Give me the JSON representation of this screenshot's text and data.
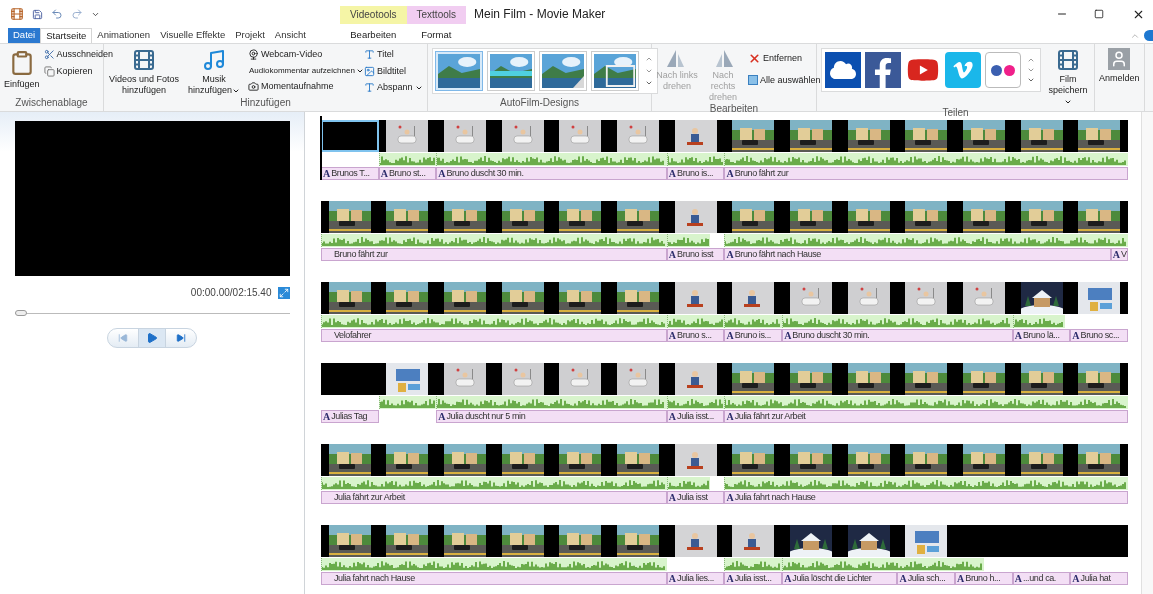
{
  "window": {
    "title": "Mein Film - Movie Maker"
  },
  "tabs": [
    {
      "label": "Datei",
      "kind": "file",
      "selected": false
    },
    {
      "label": "Startseite",
      "kind": "tab",
      "selected": true
    },
    {
      "label": "Animationen",
      "kind": "tab",
      "selected": false
    },
    {
      "label": "Visuelle Effekte",
      "kind": "tab",
      "selected": false
    },
    {
      "label": "Projekt",
      "kind": "tab",
      "selected": false
    },
    {
      "label": "Ansicht",
      "kind": "tab",
      "selected": false
    }
  ],
  "context_groups": [
    {
      "label": "Videotools",
      "color": "#f5f5a6",
      "tabs": [
        {
          "label": "Bearbeiten",
          "selected": false
        }
      ]
    },
    {
      "label": "Texttools",
      "color": "#f1cdf1",
      "tabs": [
        {
          "label": "Format",
          "selected": false
        }
      ]
    }
  ],
  "ribbon": {
    "clipboard": {
      "label": "Zwischenablage",
      "paste": "Einfügen",
      "cut": "Ausschneiden",
      "copy": "Kopieren"
    },
    "add": {
      "label": "Hinzufügen",
      "videos": "Videos und Fotos hinzufügen",
      "music": "Musik hinzufügen",
      "webcam": "Webcam-Video",
      "narration": "Audiokommentar aufzeichnen",
      "snapshot": "Momentaufnahme",
      "title": "Titel",
      "caption": "Bildtitel",
      "credits": "Abspann"
    },
    "themes": {
      "label": "AutoFilm-Designs",
      "items": [
        {
          "kind": "plain",
          "selected": true
        },
        {
          "kind": "banner",
          "selected": false
        },
        {
          "kind": "page",
          "selected": false
        },
        {
          "kind": "stack",
          "selected": false
        }
      ]
    },
    "edit": {
      "label": "Bearbeiten",
      "rotate_left": {
        "text": "Nach links drehen",
        "disabled": true
      },
      "rotate_right": {
        "text": "Nach rechts drehen",
        "disabled": true
      },
      "remove": "Entfernen",
      "select_all": "Alle auswählen"
    },
    "share": {
      "label": "Teilen",
      "items": [
        {
          "kind": "cloud"
        },
        {
          "kind": "facebook"
        },
        {
          "kind": "youtube"
        },
        {
          "kind": "vimeo"
        },
        {
          "kind": "flickr"
        }
      ],
      "save": "Film speichern"
    },
    "sign_in": "Anmelden"
  },
  "preview": {
    "time": "00:00.00/02:15.40",
    "level": 0
  },
  "timeline": {
    "rows": [
      {
        "frames": [
          {
            "kind": "blank",
            "selected": true
          },
          {
            "kind": "picture",
            "selected": false
          },
          {
            "kind": "picture",
            "selected": false
          },
          {
            "kind": "picture",
            "selected": false
          },
          {
            "kind": "picture",
            "selected": false
          },
          {
            "kind": "picture",
            "selected": false
          },
          {
            "kind": "picture",
            "selected": false
          },
          {
            "kind": "picture",
            "selected": false
          },
          {
            "kind": "picture",
            "selected": false
          },
          {
            "kind": "picture",
            "selected": false
          },
          {
            "kind": "picture",
            "selected": false
          },
          {
            "kind": "picture",
            "selected": false
          },
          {
            "kind": "picture",
            "selected": false
          },
          {
            "kind": "picture",
            "selected": false
          }
        ],
        "captions": [
          {
            "marker": "A",
            "text": "Brunos T..."
          },
          {
            "marker": "A",
            "text": "Bruno st..."
          },
          {
            "marker": "A",
            "text": "Bruno duscht 30 min."
          },
          {
            "marker": "A",
            "text": "Bruno is..."
          },
          {
            "marker": "A",
            "text": "Bruno fährt zur"
          }
        ]
      },
      {
        "frames": [
          {
            "kind": "picture",
            "selected": false
          },
          {
            "kind": "picture",
            "selected": false
          },
          {
            "kind": "picture",
            "selected": false
          },
          {
            "kind": "picture",
            "selected": false
          },
          {
            "kind": "picture",
            "selected": false
          },
          {
            "kind": "picture",
            "selected": false
          },
          {
            "kind": "picture",
            "selected": false
          },
          {
            "kind": "picture",
            "selected": false
          },
          {
            "kind": "picture",
            "selected": false
          },
          {
            "kind": "picture",
            "selected": false
          },
          {
            "kind": "picture",
            "selected": false
          },
          {
            "kind": "picture",
            "selected": false
          },
          {
            "kind": "picture",
            "selected": false
          },
          {
            "kind": "picture",
            "selected": false
          }
        ],
        "captions": [
          {
            "text": "Bruno fährt zur"
          },
          {
            "marker": "A",
            "text": "Bruno isst"
          },
          {
            "marker": "A",
            "text": "Bruno fährt nach Hause"
          },
          {
            "marker": "A",
            "text": "V"
          }
        ]
      },
      {
        "frames": [
          {
            "kind": "picture",
            "selected": false
          },
          {
            "kind": "picture",
            "selected": false
          },
          {
            "kind": "picture",
            "selected": false
          },
          {
            "kind": "picture",
            "selected": false
          },
          {
            "kind": "picture",
            "selected": false
          },
          {
            "kind": "picture",
            "selected": false
          },
          {
            "kind": "picture",
            "selected": false
          },
          {
            "kind": "picture",
            "selected": false
          },
          {
            "kind": "picture",
            "selected": false
          },
          {
            "kind": "picture",
            "selected": false
          },
          {
            "kind": "picture",
            "selected": false
          },
          {
            "kind": "picture",
            "selected": false
          },
          {
            "kind": "picture",
            "selected": false
          },
          {
            "kind": "picture",
            "selected": false
          }
        ],
        "captions": [
          {
            "text": "Velofahrer"
          },
          {
            "marker": "A",
            "text": "Bruno s..."
          },
          {
            "marker": "A",
            "text": "Bruno is..."
          },
          {
            "marker": "A",
            "text": "Bruno duscht 30 min."
          },
          {
            "marker": "A",
            "text": "Bruno lä..."
          },
          {
            "marker": "A",
            "text": "Bruno sc..."
          }
        ]
      },
      {
        "frames": [
          {
            "kind": "blank",
            "selected": false
          },
          {
            "kind": "picture",
            "selected": false
          },
          {
            "kind": "picture",
            "selected": false
          },
          {
            "kind": "picture",
            "selected": false
          },
          {
            "kind": "picture",
            "selected": false
          },
          {
            "kind": "picture",
            "selected": false
          },
          {
            "kind": "picture",
            "selected": false
          },
          {
            "kind": "picture",
            "selected": false
          },
          {
            "kind": "picture",
            "selected": false
          },
          {
            "kind": "picture",
            "selected": false
          },
          {
            "kind": "picture",
            "selected": false
          },
          {
            "kind": "picture",
            "selected": false
          },
          {
            "kind": "picture",
            "selected": false
          },
          {
            "kind": "picture",
            "selected": false
          }
        ],
        "captions": [
          {
            "marker": "A",
            "text": "Julias Tag"
          },
          {
            "marker": "A",
            "text": "Julia duscht nur 5 min"
          },
          {
            "marker": "A",
            "text": "Julia isst..."
          },
          {
            "marker": "A",
            "text": "Julia fährt zur Arbeit"
          }
        ]
      },
      {
        "frames": [
          {
            "kind": "picture",
            "selected": false
          },
          {
            "kind": "picture",
            "selected": false
          },
          {
            "kind": "picture",
            "selected": false
          },
          {
            "kind": "picture",
            "selected": false
          },
          {
            "kind": "picture",
            "selected": false
          },
          {
            "kind": "picture",
            "selected": false
          },
          {
            "kind": "picture",
            "selected": false
          },
          {
            "kind": "picture",
            "selected": false
          },
          {
            "kind": "picture",
            "selected": false
          },
          {
            "kind": "picture",
            "selected": false
          },
          {
            "kind": "picture",
            "selected": false
          },
          {
            "kind": "picture",
            "selected": false
          },
          {
            "kind": "picture",
            "selected": false
          },
          {
            "kind": "picture",
            "selected": false
          }
        ],
        "captions": [
          {
            "text": "Julia fährt zur Arbeit"
          },
          {
            "marker": "A",
            "text": "Julia isst"
          },
          {
            "marker": "A",
            "text": "Julia fahrt nach Hause"
          }
        ]
      },
      {
        "frames": [
          {
            "kind": "picture",
            "selected": false
          },
          {
            "kind": "picture",
            "selected": false
          },
          {
            "kind": "picture",
            "selected": false
          },
          {
            "kind": "picture",
            "selected": false
          },
          {
            "kind": "picture",
            "selected": false
          },
          {
            "kind": "picture",
            "selected": false
          },
          {
            "kind": "picture",
            "selected": false
          },
          {
            "kind": "picture",
            "selected": false
          },
          {
            "kind": "picture",
            "selected": false
          },
          {
            "kind": "picture",
            "selected": false
          },
          {
            "kind": "picture",
            "selected": false
          },
          {
            "kind": "blank",
            "selected": false
          },
          {
            "kind": "blank",
            "selected": false
          },
          {
            "kind": "blank",
            "selected": false
          }
        ],
        "captions": [
          {
            "text": "Julia fahrt nach Hause"
          },
          {
            "marker": "A",
            "text": "Julia lies..."
          },
          {
            "marker": "A",
            "text": "Julia isst..."
          },
          {
            "marker": "A",
            "text": "Julia löscht die Lichter"
          },
          {
            "marker": "A",
            "text": "Julia sch..."
          },
          {
            "marker": "A",
            "text": "Bruno h..."
          },
          {
            "marker": "A",
            "text": "...und ca."
          },
          {
            "marker": "A",
            "text": "Julia hat"
          }
        ]
      }
    ]
  }
}
